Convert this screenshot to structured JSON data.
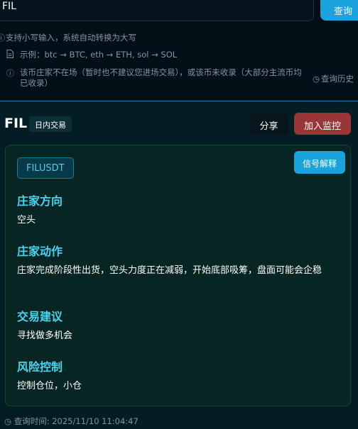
{
  "search": {
    "value": "FIL",
    "button_label": "查询"
  },
  "hints": {
    "lowercase": "支持小写输入，系统自动转换为大写",
    "example": "示例：btc → BTC, eth → ETH, sol → SOL",
    "warning": "该币庄家不在场（暂时也不建议您进场交易），或该币未收录（大部分主流币均已收录）",
    "history_link": "查询历史"
  },
  "result": {
    "coin": "FIL",
    "tag": "日内交易",
    "share_label": "分享",
    "monitor_label": "加入监控",
    "symbol": "FILUSDT",
    "signal_label": "信号解释",
    "sections": [
      {
        "title": "庄家方向",
        "body": "空头"
      },
      {
        "title": "庄家动作",
        "body": "庄家完成阶段性出货，空头力度正在减弱，开始底部吸筹，盘面可能会企稳"
      },
      {
        "title": "交易建议",
        "body": "寻找做多机会"
      },
      {
        "title": "风险控制",
        "body": "控制仓位，小仓"
      }
    ],
    "query_time": "查询时间: 2025/11/10 11:04:47"
  },
  "icons": {
    "info": "info-icon",
    "document": "document-icon",
    "clock": "clock-icon"
  },
  "colors": {
    "accent": "#1aa3dc",
    "danger": "#9a3538",
    "section_title": "#4ad2ef",
    "background": "#030f17"
  }
}
